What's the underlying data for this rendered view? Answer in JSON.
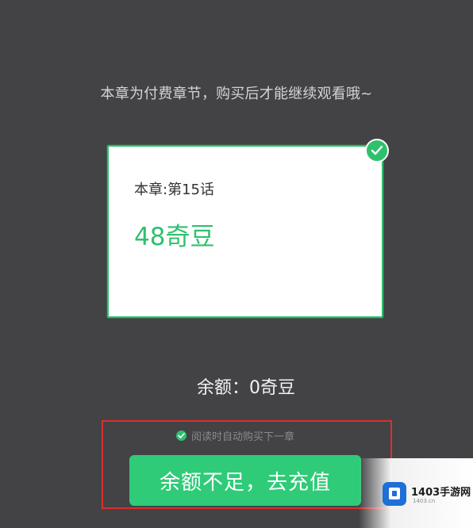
{
  "notice": "本章为付费章节，购买后才能继续观看哦~",
  "chapter": {
    "title": "本章:第15话",
    "price": "48奇豆",
    "selected": true
  },
  "balance": "余额：0奇豆",
  "auto_buy": {
    "label": "阅读时自动购买下一章",
    "checked": true
  },
  "recharge_button": "余额不足，去充值",
  "watermark": {
    "brand": "1403手游网",
    "url": "1403.cn"
  },
  "colors": {
    "accent": "#2fc06e",
    "background": "#434346",
    "highlight_border": "#d9302d"
  },
  "icons": {
    "selected_badge": "check-circle-icon",
    "auto_buy_check": "check-circle-icon",
    "watermark_logo": "cube-logo-icon"
  }
}
